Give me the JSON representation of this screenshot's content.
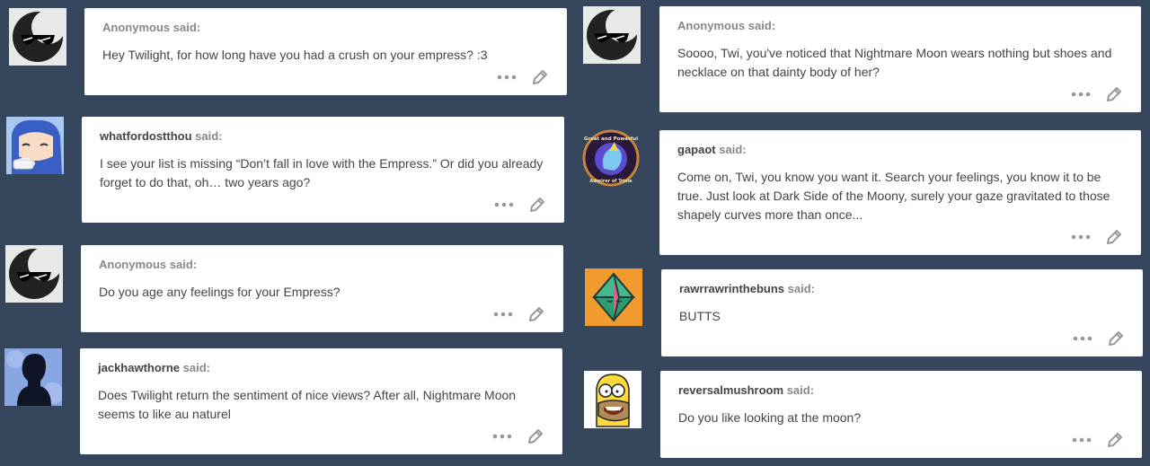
{
  "posts": [
    {
      "asker": "Anonymous",
      "said": "said:",
      "question": "Hey Twilight, for how long have you had a crush on your empress? :3",
      "avatar": "sunglasses-moon-avatar"
    },
    {
      "asker": "whatfordostthou",
      "said": "said:",
      "question": "I see your list is missing “Don’t fall in love with the Empress.” Or did you already forget to do that, oh… two years ago?",
      "avatar": "anime-girl-tea-avatar"
    },
    {
      "asker": "Anonymous",
      "said": "said:",
      "question": "Do you age any feelings for your Empress?",
      "avatar": "sunglasses-moon-avatar"
    },
    {
      "asker": "jackhawthorne",
      "said": "said:",
      "question": "Does Twilight return the sentiment of nice views? After all, Nightmare Moon seems to like au naturel",
      "avatar": "silhouette-avatar"
    },
    {
      "asker": "Anonymous",
      "said": "said:",
      "question": "Soooo, Twi, you've noticed that Nightmare Moon wears nothing but shoes and necklace on that dainty body of her?",
      "avatar": "sunglasses-moon-avatar"
    },
    {
      "asker": "gapaot",
      "said": "said:",
      "question": "Come on, Twi, you know you want it. Search your feelings, you know it to be true. Just look at Dark Side of the Moony, surely your gaze gravitated to those shapely curves more than once...",
      "avatar": "pony-badge-avatar",
      "badge_top": "Great and Powerful",
      "badge_bottom": "Admirer of Trixie"
    },
    {
      "asker": "rawrrawrinthebuns",
      "said": "said:",
      "question": "BUTTS",
      "avatar": "octahedron-avatar"
    },
    {
      "asker": "reversalmushroom",
      "said": "said:",
      "question": "Do you like looking at the moon?",
      "avatar": "homer-avatar"
    }
  ],
  "icons": {
    "more": "more-dots-icon",
    "edit": "pencil-edit-icon"
  },
  "colors": {
    "background": "#36465d",
    "card": "#ffffff",
    "text": "#444444",
    "muted": "#888888",
    "icon": "#999999"
  }
}
